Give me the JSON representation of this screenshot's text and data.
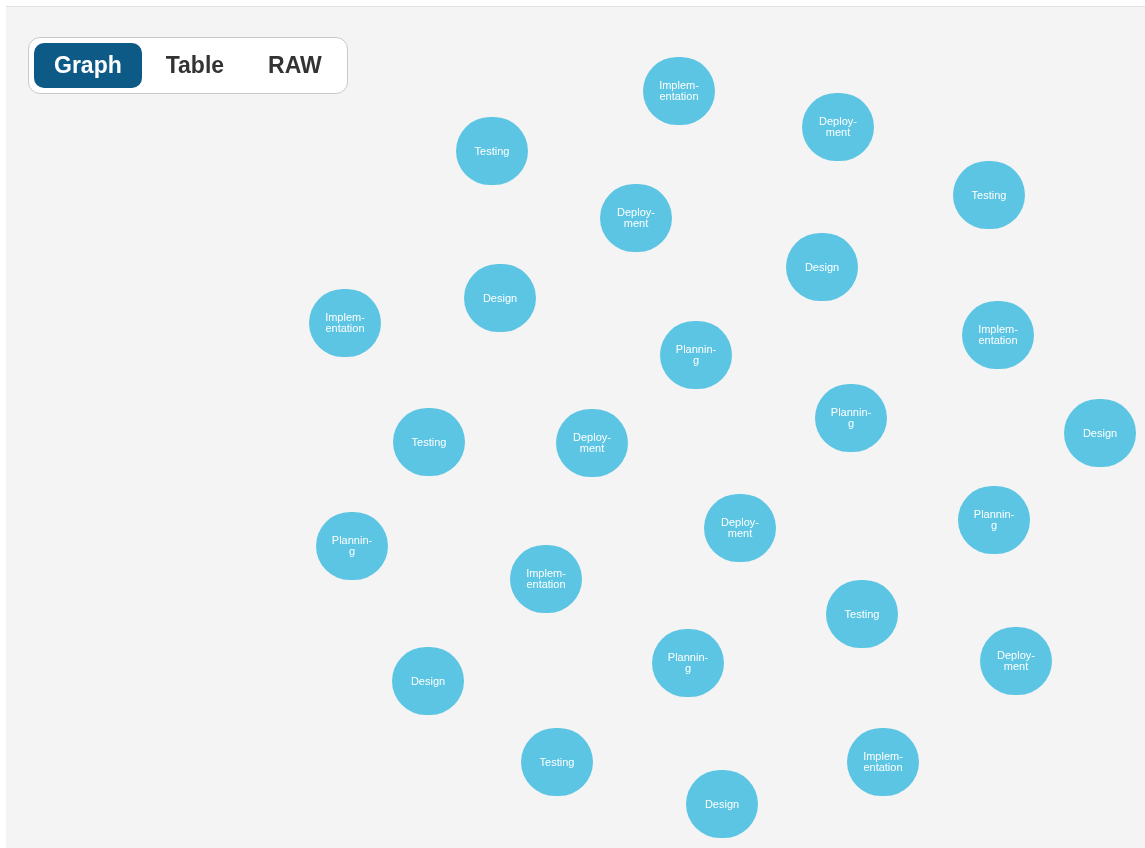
{
  "view_tabs": [
    {
      "label": "Graph",
      "selected": true
    },
    {
      "label": "Table",
      "selected": false
    },
    {
      "label": "RAW",
      "selected": false
    }
  ],
  "graph": {
    "nodes": [
      {
        "label": "Implem-\nentation"
      },
      {
        "label": "Deploy-\nment"
      },
      {
        "label": "Testing"
      },
      {
        "label": "Testing"
      },
      {
        "label": "Deploy-\nment"
      },
      {
        "label": "Design"
      },
      {
        "label": "Design"
      },
      {
        "label": "Implem-\nentation"
      },
      {
        "label": "Implem-\nentation"
      },
      {
        "label": "Plannin-\ng"
      },
      {
        "label": "Plannin-\ng"
      },
      {
        "label": "Design"
      },
      {
        "label": "Testing"
      },
      {
        "label": "Deploy-\nment"
      },
      {
        "label": "Deploy-\nment"
      },
      {
        "label": "Plannin-\ng"
      },
      {
        "label": "Plannin-\ng"
      },
      {
        "label": "Implem-\nentation"
      },
      {
        "label": "Testing"
      },
      {
        "label": "Plannin-\ng"
      },
      {
        "label": "Deploy-\nment"
      },
      {
        "label": "Design"
      },
      {
        "label": "Testing"
      },
      {
        "label": "Implem-\nentation"
      },
      {
        "label": "Design"
      }
    ]
  }
}
